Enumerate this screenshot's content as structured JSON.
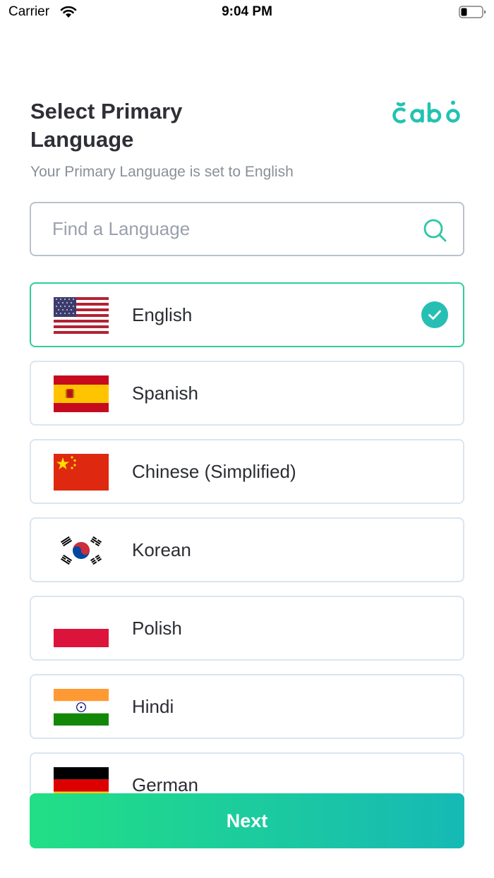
{
  "status_bar": {
    "carrier": "Carrier",
    "time": "9:04 PM"
  },
  "header": {
    "title": "Select Primary Language",
    "subtitle": "Your Primary Language is set to English",
    "logo_text": "Cabo"
  },
  "search": {
    "placeholder": "Find a Language",
    "value": ""
  },
  "languages": [
    {
      "label": "English",
      "flag": "us-flag-icon",
      "selected": true
    },
    {
      "label": "Spanish",
      "flag": "spain-flag-icon",
      "selected": false
    },
    {
      "label": "Chinese (Simplified)",
      "flag": "china-flag-icon",
      "selected": false
    },
    {
      "label": "Korean",
      "flag": "south-korea-flag-icon",
      "selected": false
    },
    {
      "label": "Polish",
      "flag": "poland-flag-icon",
      "selected": false
    },
    {
      "label": "Hindi",
      "flag": "india-flag-icon",
      "selected": false
    },
    {
      "label": "German",
      "flag": "germany-flag-icon",
      "selected": false
    }
  ],
  "footer": {
    "next_label": "Next"
  },
  "colors": {
    "accent": "#1fd39a",
    "accent_gradient_start": "#22df85",
    "accent_gradient_end": "#16b9b5",
    "selected_border": "#2dcf94",
    "check_fill": "#27bfb3",
    "logo": "#23c2b2"
  }
}
